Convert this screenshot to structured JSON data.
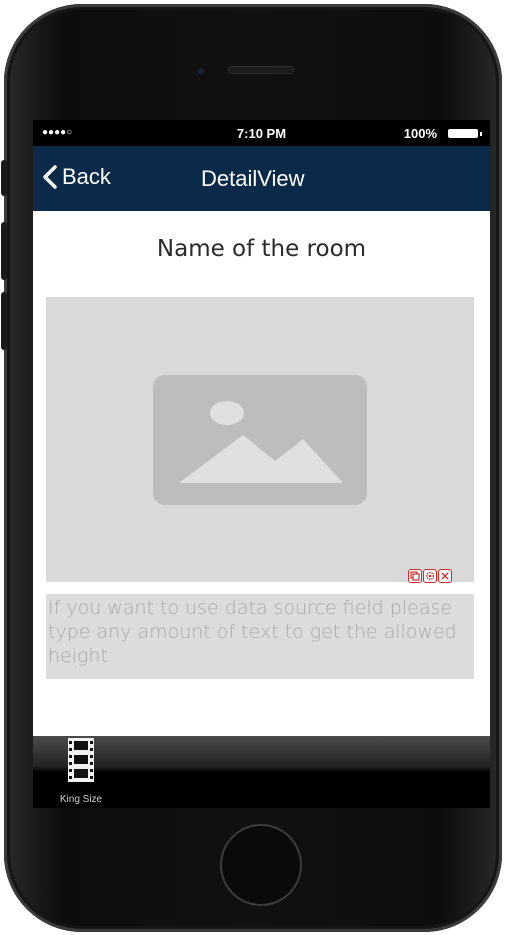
{
  "status_bar": {
    "carrier": "●●●●○",
    "time": "7:10 PM",
    "battery": "100%"
  },
  "nav_bar": {
    "back_label": "Back",
    "title": "DetailView",
    "color": "#0b2a4a"
  },
  "content": {
    "room_title": "Name of the room",
    "image_placeholder_icon": "image-placeholder-icon",
    "edit_toolbar": [
      "copy-icon",
      "settings-icon",
      "close-icon"
    ],
    "description": "If you want to use data source field please type any amount of text to get the allowed height"
  },
  "tab_bar": {
    "items": [
      {
        "label": "King Size",
        "icon": "film-strip-icon"
      }
    ]
  }
}
